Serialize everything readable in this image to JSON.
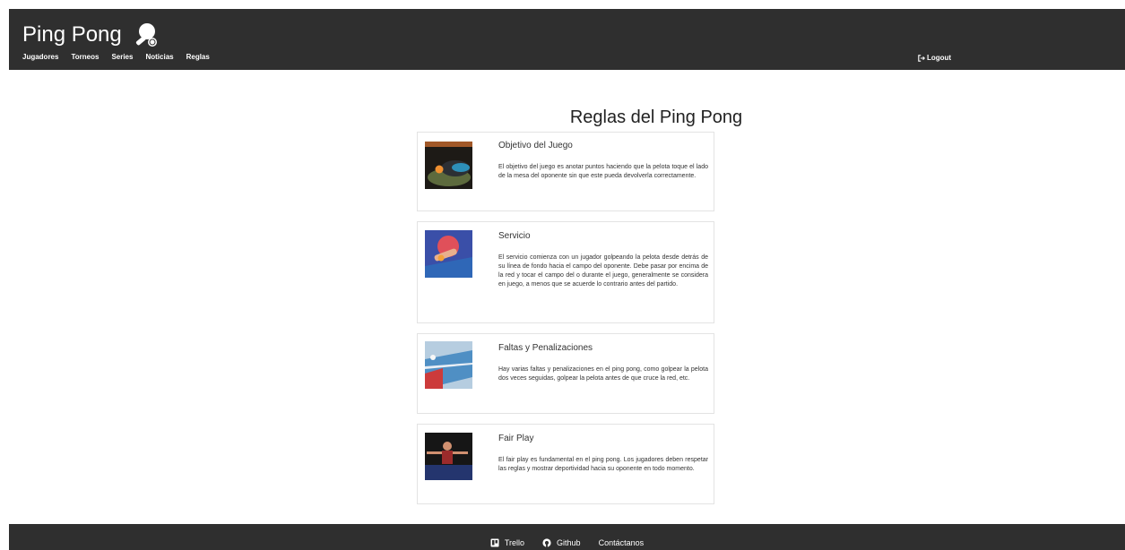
{
  "header": {
    "brand": "Ping Pong",
    "brand_icon": "ping-pong-paddle-icon",
    "nav": [
      "Jugadores",
      "Torneos",
      "Series",
      "Noticias",
      "Reglas"
    ],
    "logout_label": "Logout",
    "logout_icon": "logout-icon"
  },
  "main": {
    "title": "Reglas del Ping Pong",
    "rules": [
      {
        "title": "Objetivo del Juego",
        "text": "El objetivo del juego es anotar puntos haciendo que la pelota toque el lado de la mesa del oponente sin que este pueda devolverla correctamente.",
        "image_icon": "paddle-and-ball-photo"
      },
      {
        "title": "Servicio",
        "text": "El servicio comienza con un jugador golpeando la pelota desde detrás de su línea de fondo hacia el campo del oponente. Debe pasar por encima de la red y tocar el campo del o durante el juego, generalmente se considera en juego, a menos que se acuerde lo contrario antes del partido.",
        "image_icon": "serve-photo"
      },
      {
        "title": "Faltas y Penalizaciones",
        "text": "Hay varias faltas y penalizaciones en el ping pong, como golpear la pelota dos veces seguidas, golpear la pelota antes de que cruce la red, etc.",
        "image_icon": "table-photo"
      },
      {
        "title": "Fair Play",
        "text": "El fair play es fundamental en el ping pong. Los jugadores deben respetar las reglas y mostrar deportividad hacia su oponente en todo momento.",
        "image_icon": "player-photo"
      }
    ]
  },
  "footer": {
    "links": [
      {
        "label": "Trello",
        "icon": "trello-icon"
      },
      {
        "label": "Github",
        "icon": "github-icon"
      },
      {
        "label": "Contáctanos",
        "icon": ""
      }
    ]
  },
  "colors": {
    "header_bg": "#2f2f2f",
    "footer_bg": "#2f2f2f",
    "card_border": "#e3e3e3"
  }
}
